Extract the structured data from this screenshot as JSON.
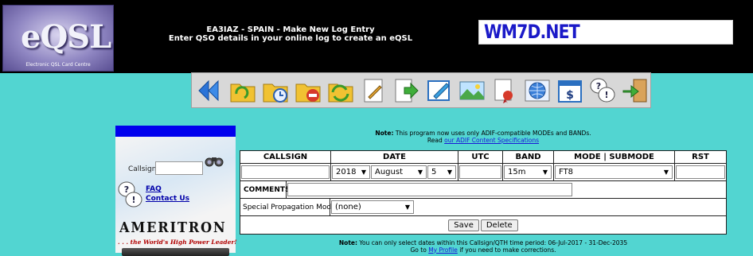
{
  "header": {
    "logo_text": "eQSL",
    "logo_caption": "Electronic QSL Card Centre",
    "title_line1": "EA3IAZ - SPAIN - Make New Log Entry",
    "title_line2": "Enter QSO details in your online log to create an eQSL",
    "banner_text": "WM7D.NET"
  },
  "toolbar": {
    "icons": [
      "back-double-arrow-icon",
      "folder-refresh-icon",
      "folder-clock-icon",
      "folder-delete-icon",
      "folder-sync-icon",
      "note-edit-icon",
      "document-export-icon",
      "pencil-edit-icon",
      "picture-icon",
      "award-certificate-icon",
      "globe-icon",
      "dollar-calendar-icon",
      "help-bubbles-icon",
      "exit-door-icon"
    ]
  },
  "sidebar": {
    "callsign_label": "Callsign:",
    "faq": "FAQ",
    "contact": "Contact Us",
    "ad_title": "AMERITRON",
    "ad_tagline": ". . . the World's High Power Leader!"
  },
  "note1": {
    "prefix": "Note:",
    "line1": " This program now uses only ADIF-compatible MODEs and BANDs.",
    "line2_pre": "Read ",
    "link": "our ADIF Content Specifications"
  },
  "form": {
    "headers": [
      "CALLSIGN",
      "DATE",
      "UTC",
      "BAND",
      "MODE | SUBMODE",
      "RST"
    ],
    "callsign_value": "",
    "year": "2018",
    "month": "August",
    "day": "5",
    "utc_value": "",
    "band": "15m",
    "mode": "FT8",
    "rst_value": "",
    "comments_label": "COMMENTS",
    "prop_mode_label": "Special Propagation Mode",
    "prop_mode_value": "(none)",
    "save_label": "Save",
    "delete_label": "Delete"
  },
  "note2": {
    "prefix": "Note:",
    "line1": " You can only select dates within this Callsign/QTH time period: 06-Jul-2017 - 31-Dec-2035",
    "line2_pre": "Go to ",
    "link": "My Profile",
    "line2_post": " if you need to make corrections."
  },
  "colors": {
    "background": "#52d5d1",
    "header": "#000000",
    "banner_text": "#1a19c8",
    "link": "#1a1ad8"
  }
}
